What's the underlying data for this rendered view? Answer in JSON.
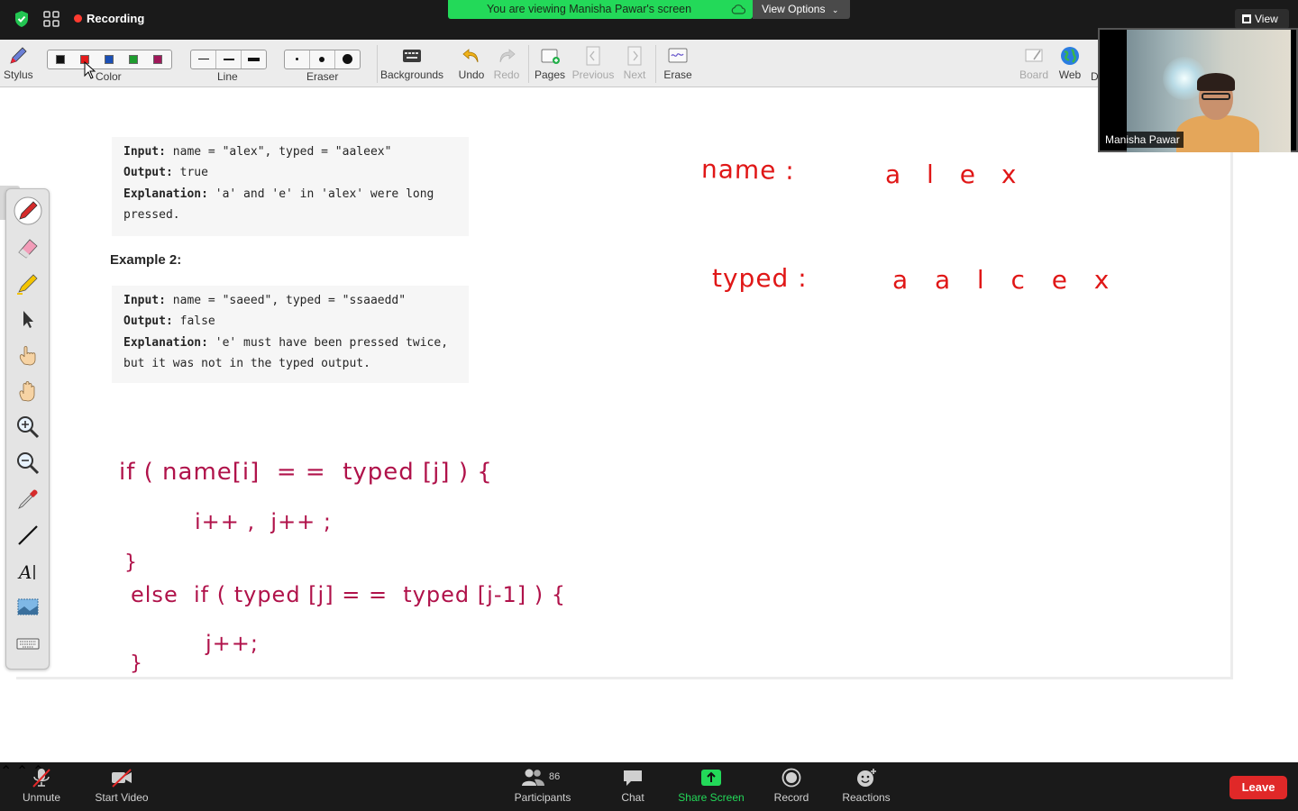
{
  "topbar": {
    "recording_label": "Recording",
    "viewing_banner": "You are viewing Manisha Pawar's screen",
    "view_options": "View Options",
    "view_button": "View"
  },
  "whiteboard_toolbar": {
    "stylus": "Stylus",
    "color": "Color",
    "line": "Line",
    "eraser": "Eraser",
    "backgrounds": "Backgrounds",
    "undo": "Undo",
    "redo": "Redo",
    "pages": "Pages",
    "previous": "Previous",
    "next": "Next",
    "erase": "Erase",
    "board": "Board",
    "web": "Web",
    "cut_off": "D",
    "colors": [
      "#111111",
      "#e31b1b",
      "#1a4fb5",
      "#1e9c2e",
      "#a0185a"
    ]
  },
  "problem": {
    "ex1_line1_label": "Input:",
    "ex1_line1_value": " name = \"alex\", typed = \"aaleex\"",
    "ex1_line2_label": "Output:",
    "ex1_line2_value": " true",
    "ex1_line3_label": "Explanation:",
    "ex1_line3_value": " 'a' and 'e' in 'alex' were long",
    "ex1_line4": "pressed.",
    "ex2_heading": "Example 2:",
    "ex2_line1_label": "Input:",
    "ex2_line1_value": " name = \"saeed\", typed = \"ssaaedd\"",
    "ex2_line2_label": "Output:",
    "ex2_line2_value": " false",
    "ex2_line3_label": "Explanation:",
    "ex2_line3_value": " 'e' must have been pressed twice,",
    "ex2_line4": "but it was not in the typed output."
  },
  "handwriting": {
    "name_label": "name :",
    "name_value": "a l e x",
    "typed_label": "typed :",
    "typed_value": "a  a  l  c  e  x",
    "code_line1": "if ( name[i]  = =  typed [j] ) {",
    "code_line2": "i++ ,  j++ ;",
    "code_line3": "}",
    "code_line4": "else  if ( typed [j] = =  typed [j-1] ) {",
    "code_line5": "j++;",
    "code_line6": "}"
  },
  "video": {
    "participant_name": "Manisha Pawar"
  },
  "bottombar": {
    "unmute": "Unmute",
    "start_video": "Start Video",
    "participants": "Participants",
    "participant_count": "86",
    "chat": "Chat",
    "share_screen": "Share Screen",
    "record": "Record",
    "reactions": "Reactions",
    "leave": "Leave"
  }
}
